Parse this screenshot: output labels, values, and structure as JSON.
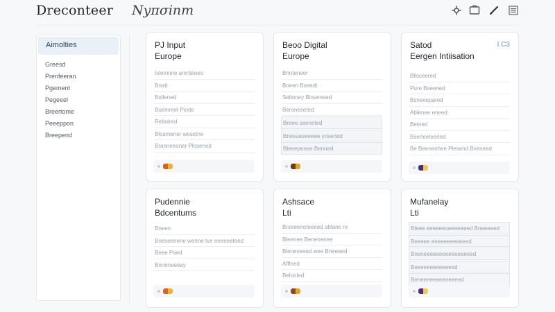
{
  "header": {
    "brand": "Dreconteer",
    "subtitle": "Nyπσinm",
    "tools": [
      {
        "icon": "settings-gear-icon"
      },
      {
        "icon": "window-icon"
      },
      {
        "icon": "pen-edit-icon"
      },
      {
        "icon": "menu-list-icon"
      }
    ]
  },
  "sidebar": {
    "active": "Aimolties",
    "items": [
      "Greesd",
      "Prenfeeran",
      "Pgement",
      "Pegeeel",
      "Breertome",
      "Peeeppon",
      "Breepend"
    ]
  },
  "cards": [
    {
      "title": [
        "PJ Input",
        "Europe"
      ],
      "tag": "",
      "rows": [
        {
          "text": "Islemnne amnteoes",
          "boxed": false
        },
        {
          "text": "Bnatt",
          "boxed": false
        },
        {
          "text": "Bollened",
          "boxed": false
        },
        {
          "text": "Buemmet Pexte",
          "boxed": false
        },
        {
          "text": "Rebolred",
          "boxed": false
        },
        {
          "text": "Blosmener wesetne",
          "boxed": false
        },
        {
          "text": "Branneeoner Plosened",
          "boxed": false
        }
      ],
      "footer_colors": [
        "#d4622a",
        "#f0b429"
      ]
    },
    {
      "title": [
        "Beoo Digital",
        "Europe"
      ],
      "tag": "",
      "rows": [
        {
          "text": "Bnnteneer",
          "boxed": false
        },
        {
          "text": "Boeen Bseedt",
          "boxed": false
        },
        {
          "text": "Seltoney Bloveneed",
          "boxed": false
        },
        {
          "text": "Beroneseted",
          "boxed": false
        },
        {
          "text": "Breee seeneted",
          "boxed": true
        },
        {
          "text": "Bnesueseeeee ynsened",
          "boxed": true
        },
        {
          "text": "Bleeepenee Benned",
          "boxed": true
        }
      ],
      "footer_colors": [
        "#6b3b1a",
        "#e0a623"
      ]
    },
    {
      "title": [
        "Satod",
        "Eergen Intiisation"
      ],
      "tag": "I C3",
      "rows": [
        {
          "text": "Blisceered",
          "boxed": false
        },
        {
          "text": "Pure Bseened",
          "boxed": false
        },
        {
          "text": "Bsneeepared",
          "boxed": false
        },
        {
          "text": "Ablenee eneed",
          "boxed": false
        },
        {
          "text": "Betned",
          "boxed": false
        },
        {
          "text": "Bseneeteened",
          "boxed": false
        },
        {
          "text": "Be Beenenhee Plesend Bveneed",
          "boxed": false
        }
      ],
      "footer_colors": [
        "#4b2e83",
        "#f2c94c"
      ]
    },
    {
      "title": [
        "Pudennie",
        "Bdcentums"
      ],
      "tag": "",
      "rows": [
        {
          "text": "Bneen",
          "boxed": false
        },
        {
          "text": "Bneseenene wenne tve eeeeeeteed",
          "boxed": false
        },
        {
          "text": "Beee Paed",
          "boxed": false
        },
        {
          "text": "Bnneneeeay",
          "boxed": false
        }
      ],
      "footer_colors": [
        "#d4622a",
        "#f0b429"
      ]
    },
    {
      "title": [
        "Ashsace",
        "Lti"
      ],
      "tag": "",
      "rows": [
        {
          "text": "Brseeeneteeeed ablane re",
          "boxed": false
        },
        {
          "text": "Bleenee Benenenee",
          "boxed": false
        },
        {
          "text": "Bleneveeed wee Bneeeed",
          "boxed": false
        },
        {
          "text": "Afflned",
          "boxed": false
        },
        {
          "text": "Behioled",
          "boxed": false
        }
      ],
      "footer_colors": [
        "#8a4b1f",
        "#e0a623"
      ]
    },
    {
      "title": [
        "Mufanelay",
        "Lti"
      ],
      "tag": "",
      "rows": [
        {
          "text": "Bleee eeeeeeoeeeeeeed Bneeeeed",
          "boxed": true
        },
        {
          "text": "Beeeee eeeeeeeeeeeed",
          "boxed": true
        },
        {
          "text": "Bneneeeeeeeeeeeeeeeed",
          "boxed": true
        },
        {
          "text": "Beeeeeeeeeeeeed",
          "boxed": true
        },
        {
          "text": "Beneeeeeeeeneeeed",
          "boxed": true
        }
      ],
      "footer_colors": [
        "#4b2e83",
        "#f2c94c"
      ]
    }
  ]
}
